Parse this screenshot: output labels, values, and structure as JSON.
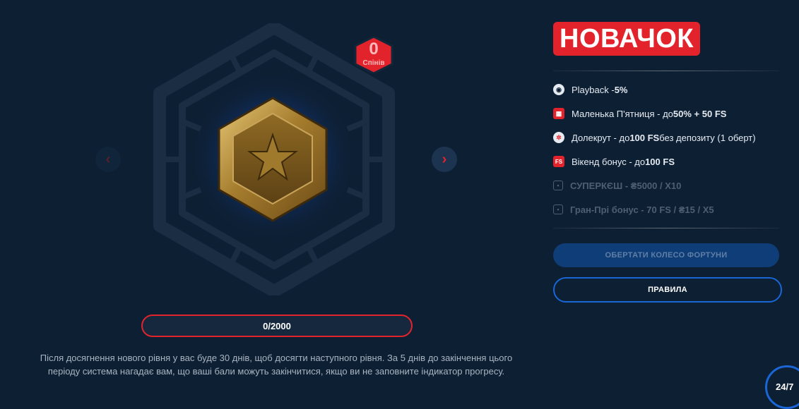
{
  "level": {
    "spins": {
      "count": "0",
      "label": "Спінів"
    },
    "progress": {
      "text": "0/2000",
      "value": 0,
      "max": 2000
    },
    "description": "Після досягнення нового рівня у вас буде 30 днів, щоб досягти наступного рівня. За 5 днів до закінчення цього періоду система нагадає вам, що ваші бали можуть закінчитися, якщо ви не заповните індикатор прогресу.",
    "nav": {
      "prev": "‹",
      "next": "›"
    }
  },
  "panel": {
    "level_name": "НОВАЧОК",
    "perks": [
      {
        "icon": "playback-icon",
        "text": "Playback - ",
        "bold": "5%",
        "tail": "",
        "locked": false
      },
      {
        "icon": "calendar-icon",
        "text": "Маленька П'ятниця - до ",
        "bold": "50% + 50 FS",
        "tail": "",
        "locked": false
      },
      {
        "icon": "wheel-icon",
        "text": "Долекрут - до ",
        "bold": "100 FS",
        "tail": " без депозиту (1 оберт)",
        "locked": false
      },
      {
        "icon": "fs-icon",
        "text": "Вікенд бонус - до ",
        "bold": "100 FS",
        "tail": "",
        "locked": false
      },
      {
        "icon": "lock-icon",
        "text": "СУПЕРКЄШ - ₴5000 / X10",
        "bold": "",
        "tail": "",
        "locked": true
      },
      {
        "icon": "lock-icon",
        "text": "Гран-Прі бонус - 70 FS / ₴15 / X5",
        "bold": "",
        "tail": "",
        "locked": true
      }
    ],
    "buttons": {
      "spin": "ОБЕРТАТИ КОЛЕСО ФОРТУНИ",
      "rules": "ПРАВИЛА"
    }
  },
  "support": {
    "label": "24/7"
  },
  "colors": {
    "background": "#0d1f33",
    "accent_red": "#e3232c",
    "accent_blue": "#1a66d6",
    "medal_gold": "#b8903a"
  }
}
